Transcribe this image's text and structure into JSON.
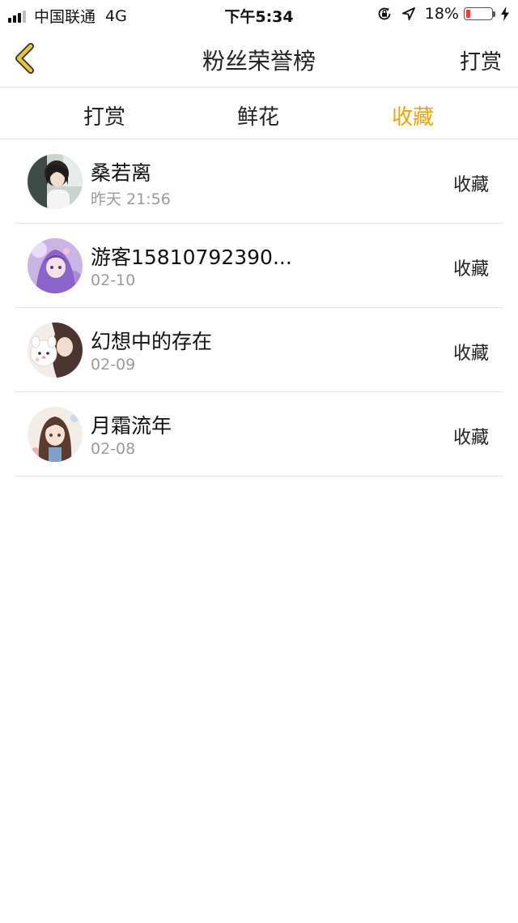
{
  "status_bar": {
    "carrier": "中国联通",
    "network": "4G",
    "time": "下午5:34",
    "battery_percent": "18%",
    "battery_level": 0.18,
    "icons": [
      "signal-icon",
      "orientation-lock-icon",
      "location-icon",
      "battery-icon",
      "charging-icon"
    ]
  },
  "nav": {
    "title": "粉丝荣誉榜",
    "action_label": "打赏",
    "back_icon": "chevron-left-icon"
  },
  "tabs": [
    {
      "label": "打赏",
      "active": false
    },
    {
      "label": "鲜花",
      "active": false
    },
    {
      "label": "收藏",
      "active": true
    }
  ],
  "fans": [
    {
      "name": "桑若离",
      "date": "昨天 21:56",
      "action": "收藏"
    },
    {
      "name": "游客15810792390...",
      "date": "02-10",
      "action": "收藏"
    },
    {
      "name": "幻想中的存在",
      "date": "02-09",
      "action": "收藏"
    },
    {
      "name": "月霜流年",
      "date": "02-08",
      "action": "收藏"
    }
  ],
  "colors": {
    "accent": "#f0a30a",
    "back_icon": "#e8c63a",
    "divider": "#e5e5e5",
    "secondary_text": "#9b9b9b",
    "battery_low": "#ff3b30"
  }
}
